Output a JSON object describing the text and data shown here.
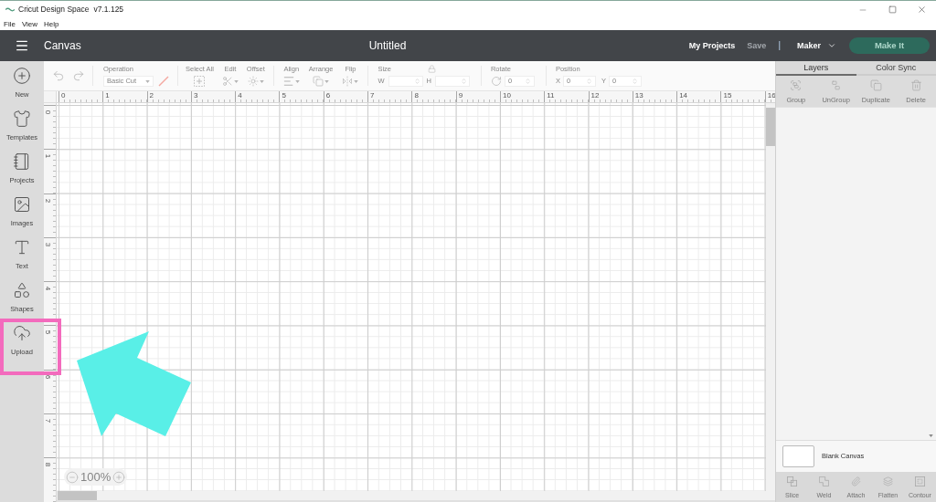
{
  "window": {
    "title": "Cricut Design Space",
    "version": "v7.1.125"
  },
  "menu": [
    "File",
    "View",
    "Help"
  ],
  "header": {
    "section": "Canvas",
    "document_title": "Untitled",
    "links": [
      {
        "label": "My Projects",
        "disabled": false
      },
      {
        "label": "Save",
        "disabled": true
      }
    ],
    "separator": "|",
    "machine": "Maker",
    "make_button": {
      "label": "Make It",
      "disabled": true
    }
  },
  "sidebar": {
    "items": [
      {
        "label": "New",
        "highlighted": false
      },
      {
        "label": "Templates",
        "highlighted": false
      },
      {
        "label": "Projects",
        "highlighted": false
      },
      {
        "label": "Images",
        "highlighted": false
      },
      {
        "label": "Text",
        "highlighted": false
      },
      {
        "label": "Shapes",
        "highlighted": false
      },
      {
        "label": "Upload",
        "highlighted": true
      }
    ]
  },
  "toolbar": {
    "disabled": true,
    "operation": {
      "label": "Operation",
      "value": "Basic Cut"
    },
    "edit_tools": [
      "Select All",
      "Edit",
      "Offset"
    ],
    "arrange_tools": [
      "Align",
      "Arrange",
      "Flip"
    ],
    "size": {
      "label": "Size",
      "fields": [
        {
          "label": "W"
        },
        {
          "label": "H"
        }
      ]
    },
    "rotate": {
      "label": "Rotate",
      "value": "0"
    },
    "position": {
      "label": "Position",
      "fields": [
        {
          "label": "X",
          "value": "0"
        },
        {
          "label": "Y",
          "value": "0"
        }
      ]
    }
  },
  "rulers": {
    "horizontal": [
      "0",
      "1",
      "2",
      "3",
      "4",
      "5",
      "6",
      "7",
      "8",
      "9",
      "10",
      "11",
      "12",
      "13",
      "14",
      "15",
      "16"
    ],
    "vertical": [
      "0",
      "1",
      "2",
      "3",
      "4",
      "5",
      "6",
      "7",
      "8"
    ]
  },
  "zoom": {
    "value": "100%"
  },
  "layers_panel": {
    "tabs": [
      {
        "label": "Layers",
        "selected": true
      },
      {
        "label": "Color Sync",
        "selected": false
      }
    ],
    "actions": [
      {
        "label": "Group",
        "disabled": true
      },
      {
        "label": "UnGroup",
        "disabled": true
      },
      {
        "label": "Duplicate",
        "disabled": true
      },
      {
        "label": "Delete",
        "disabled": true
      }
    ],
    "canvas_layer": {
      "label": "Blank Canvas"
    },
    "bottom_actions": [
      {
        "label": "Slice",
        "disabled": true
      },
      {
        "label": "Weld",
        "disabled": true
      },
      {
        "label": "Attach",
        "disabled": true
      },
      {
        "label": "Flatten",
        "disabled": true
      },
      {
        "label": "Contour",
        "disabled": true
      }
    ]
  }
}
